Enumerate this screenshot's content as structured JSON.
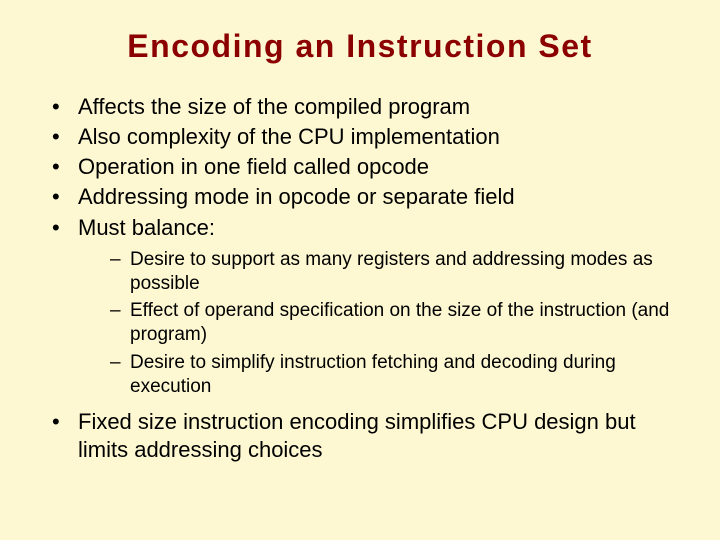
{
  "title": "Encoding an Instruction Set",
  "bullets": {
    "b0": "Affects the size of the compiled program",
    "b1": "Also complexity of the CPU implementation",
    "b2": "Operation in one field called opcode",
    "b3": "Addressing mode in opcode or separate field",
    "b4": "Must balance:",
    "b5": "Fixed size instruction encoding simplifies CPU design but limits addressing choices"
  },
  "sub": {
    "s0": "Desire to support as many registers and addressing modes as possible",
    "s1": "Effect of operand specification on the size of the instruction (and program)",
    "s2": "Desire to simplify instruction fetching and decoding during execution"
  }
}
